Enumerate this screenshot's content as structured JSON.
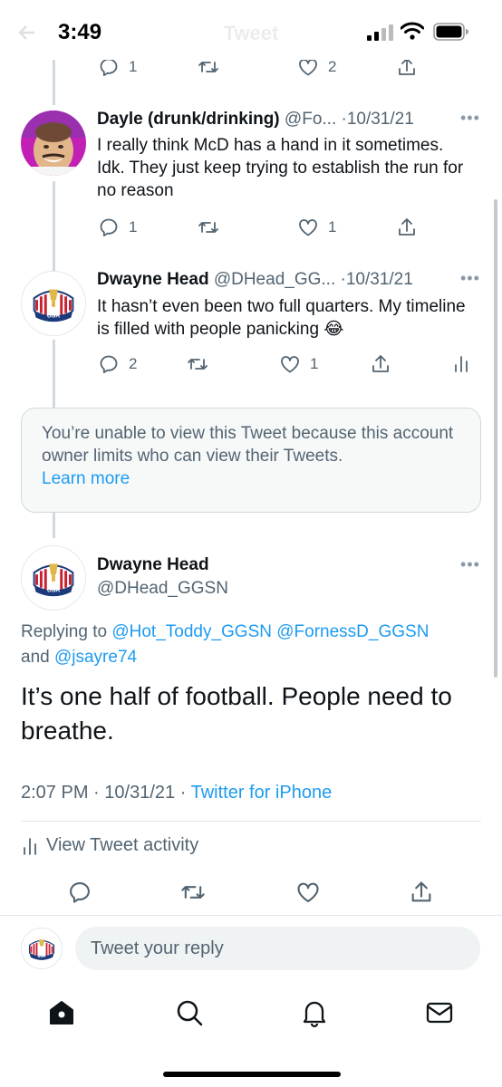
{
  "status_bar": {
    "time": "3:49",
    "nav_title": "Tweet"
  },
  "prev_tweet_actions": {
    "reply_count": "1",
    "like_count": "2"
  },
  "tweets": [
    {
      "display_name": "Dayle (drunk/drinking)",
      "handle": "@Fo...",
      "date": "·10/31/21",
      "more": "•••",
      "text": "I really think McD has a hand in it sometimes.  Idk. They just keep trying to establish the run for no reason",
      "reply_count": "1",
      "like_count": "1"
    },
    {
      "display_name": "Dwayne Head",
      "handle": "@DHead_GG...",
      "date": "·10/31/21",
      "more": "•••",
      "text": "It hasn’t even been two full quarters. My timeline is filled with people panicking 😂",
      "reply_count": "2",
      "like_count": "1"
    }
  ],
  "limited_notice": {
    "text": "You’re unable to view this Tweet because this account owner limits who can view their Tweets.",
    "link": "Learn more"
  },
  "main_tweet": {
    "display_name": "Dwayne Head",
    "handle": "@DHead_GGSN",
    "more": "•••",
    "replying_prefix": "Replying to",
    "mention_1": "@Hot_Toddy_GGSN",
    "mention_2": "@FornessD_GGSN",
    "replying_and": "and",
    "mention_3": "@jsayre74",
    "text": "It’s one half of football. People need to breathe.",
    "time": "2:07 PM",
    "date": "10/31/21",
    "sep": "·",
    "source": "Twitter for iPhone",
    "activity": "View Tweet activity"
  },
  "reply_bar": {
    "placeholder": "Tweet your reply"
  },
  "avatar_badge": {
    "text": "USA",
    "year": "2020"
  },
  "colors": {
    "accent": "#1d9bf0",
    "muted": "#536471",
    "text": "#0f1419",
    "border": "#cfd9de"
  }
}
